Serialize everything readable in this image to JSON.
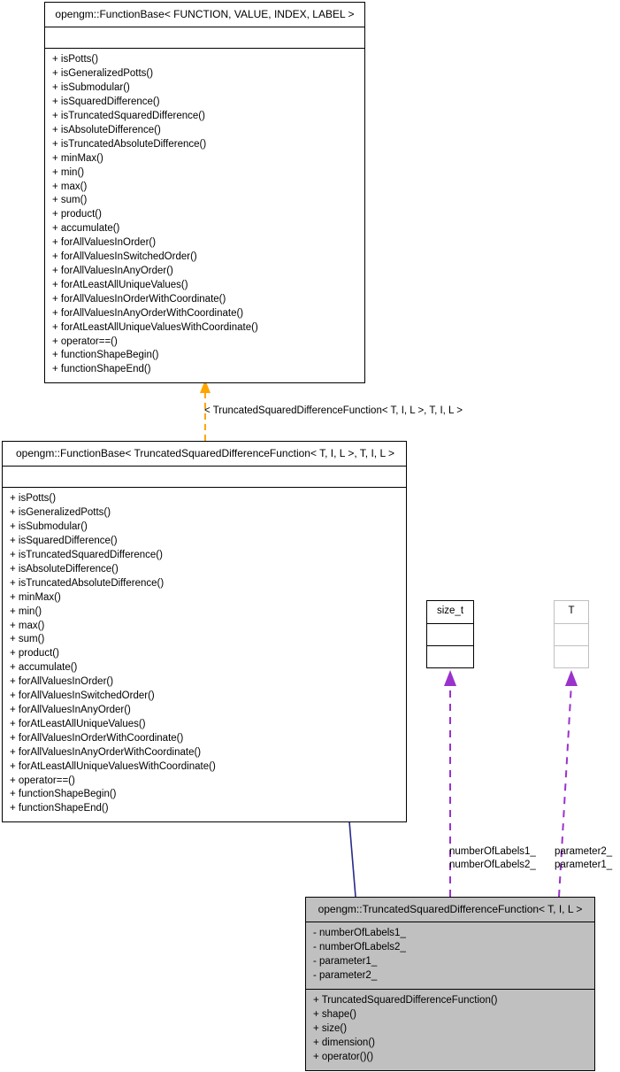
{
  "diagram": {
    "type": "uml-class-diagram",
    "colors": {
      "box_fill_highlight": "#c0c0c0",
      "box_border": "#000000",
      "box_border_light": "#c0c0c0",
      "inheritance_arrow": "#2a2a8c",
      "template_arrow": "#ffa500",
      "association_arrow": "#9a32cd"
    }
  },
  "base_generic": {
    "title": "opengm::FunctionBase< FUNCTION, VALUE, INDEX, LABEL >",
    "attributes": [],
    "methods": [
      "+ isPotts()",
      "+ isGeneralizedPotts()",
      "+ isSubmodular()",
      "+ isSquaredDifference()",
      "+ isTruncatedSquaredDifference()",
      "+ isAbsoluteDifference()",
      "+ isTruncatedAbsoluteDifference()",
      "+ minMax()",
      "+ min()",
      "+ max()",
      "+ sum()",
      "+ product()",
      "+ accumulate()",
      "+ forAllValuesInOrder()",
      "+ forAllValuesInSwitchedOrder()",
      "+ forAllValuesInAnyOrder()",
      "+ forAtLeastAllUniqueValues()",
      "+ forAllValuesInOrderWithCoordinate()",
      "+ forAllValuesInAnyOrderWithCoordinate()",
      "+ forAtLeastAllUniqueValuesWithCoordinate()",
      "+ operator==()",
      "+ functionShapeBegin()",
      "+ functionShapeEnd()"
    ]
  },
  "base_specialized": {
    "title": "opengm::FunctionBase< TruncatedSquaredDifferenceFunction< T, I, L >, T, I, L >",
    "attributes": [],
    "methods": [
      "+ isPotts()",
      "+ isGeneralizedPotts()",
      "+ isSubmodular()",
      "+ isSquaredDifference()",
      "+ isTruncatedSquaredDifference()",
      "+ isAbsoluteDifference()",
      "+ isTruncatedAbsoluteDifference()",
      "+ minMax()",
      "+ min()",
      "+ max()",
      "+ sum()",
      "+ product()",
      "+ accumulate()",
      "+ forAllValuesInOrder()",
      "+ forAllValuesInSwitchedOrder()",
      "+ forAllValuesInAnyOrder()",
      "+ forAtLeastAllUniqueValues()",
      "+ forAllValuesInOrderWithCoordinate()",
      "+ forAllValuesInAnyOrderWithCoordinate()",
      "+ forAtLeastAllUniqueValuesWithCoordinate()",
      "+ operator==()",
      "+ functionShapeBegin()",
      "+ functionShapeEnd()"
    ]
  },
  "type_size_t": {
    "title": "size_t",
    "attributes": [],
    "methods": []
  },
  "type_t": {
    "title": "T",
    "attributes": [],
    "methods": []
  },
  "derived": {
    "title": "opengm::TruncatedSquaredDifferenceFunction< T, I, L >",
    "attributes": [
      "- numberOfLabels1_",
      "- numberOfLabels2_",
      "- parameter1_",
      "- parameter2_"
    ],
    "methods": [
      "+ TruncatedSquaredDifferenceFunction()",
      "+ shape()",
      "+ size()",
      "+ dimension()",
      "+ operator()()"
    ]
  },
  "edges": {
    "template_binding_label": "< TruncatedSquaredDifferenceFunction< T, I, L >, T, I, L >",
    "assoc_size_t_line1": "numberOfLabels1_",
    "assoc_size_t_line2": "numberOfLabels2_",
    "assoc_size_t_sep": "/",
    "assoc_t_line1": "parameter2_",
    "assoc_t_line2": "parameter1_",
    "assoc_t_sep": "/"
  }
}
